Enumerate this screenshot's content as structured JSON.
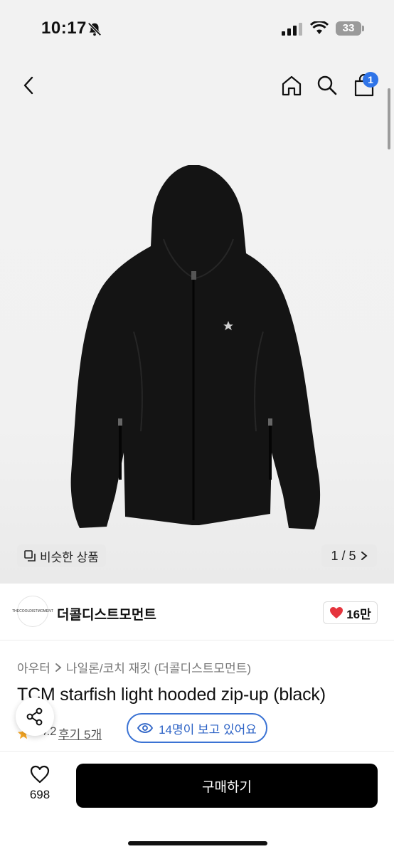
{
  "status_bar": {
    "time": "10:17",
    "battery": "33"
  },
  "nav": {
    "cart_badge": "1"
  },
  "gallery": {
    "similar_label": "비슷한 상품",
    "pager": "1 / 5"
  },
  "brand": {
    "logo_text": "THECOOLDISTMOMENT",
    "name": "더콜디스트모먼트",
    "likes": "16만"
  },
  "product": {
    "breadcrumb": [
      "아우터",
      "나일론/코치 재킷 (더콜디스트모먼트)"
    ],
    "title": "TCM starfish light hooded zip-up (black)",
    "rating": "4.2",
    "review_link": "후기 5개",
    "viewers": "14명이 보고 있어요"
  },
  "bottom": {
    "wish_count": "698",
    "buy_label": "구매하기"
  },
  "colors": {
    "accent_blue": "#2f74e8",
    "heart_red": "#e5343d",
    "buy_button": "#000000"
  }
}
